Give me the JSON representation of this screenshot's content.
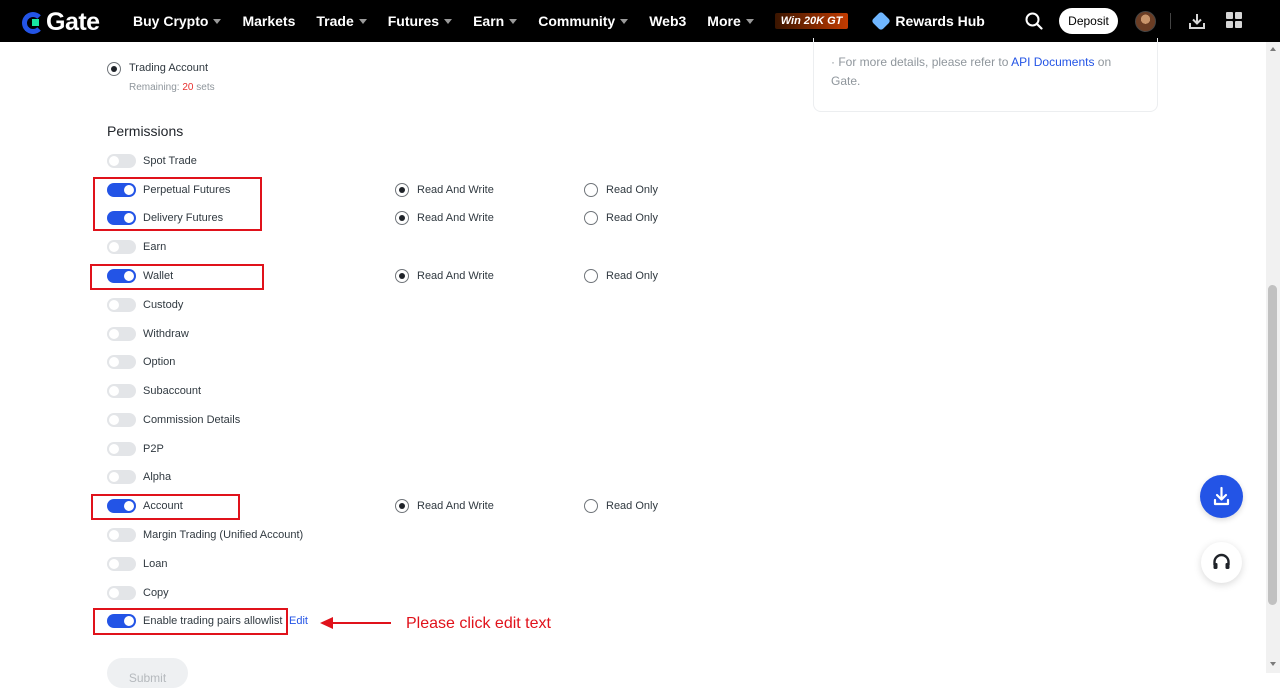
{
  "header": {
    "logo_text": "Gate",
    "nav": [
      {
        "label": "Buy Crypto",
        "dropdown": true
      },
      {
        "label": "Markets",
        "dropdown": false
      },
      {
        "label": "Trade",
        "dropdown": true
      },
      {
        "label": "Futures",
        "dropdown": true
      },
      {
        "label": "Earn",
        "dropdown": true
      },
      {
        "label": "Community",
        "dropdown": true
      },
      {
        "label": "Web3",
        "dropdown": false
      },
      {
        "label": "More",
        "dropdown": true
      }
    ],
    "promo_label": "Win 20K GT",
    "rewards_label": "Rewards Hub",
    "deposit_label": "Deposit"
  },
  "account_type": {
    "option_label": "Trading Account",
    "selected": true,
    "remaining_prefix": "Remaining: ",
    "remaining_count": "20",
    "remaining_suffix": " sets"
  },
  "permissions": {
    "title": "Permissions",
    "rw_label": "Read And Write",
    "ro_label": "Read Only",
    "items": [
      {
        "label": "Spot Trade",
        "enabled": false
      },
      {
        "label": "Perpetual Futures",
        "enabled": true,
        "mode": "Read And Write"
      },
      {
        "label": "Delivery Futures",
        "enabled": true,
        "mode": "Read And Write"
      },
      {
        "label": "Earn",
        "enabled": false
      },
      {
        "label": "Wallet",
        "enabled": true,
        "mode": "Read And Write"
      },
      {
        "label": "Custody",
        "enabled": false
      },
      {
        "label": "Withdraw",
        "enabled": false
      },
      {
        "label": "Option",
        "enabled": false
      },
      {
        "label": "Subaccount",
        "enabled": false
      },
      {
        "label": "Commission Details",
        "enabled": false
      },
      {
        "label": "P2P",
        "enabled": false
      },
      {
        "label": "Alpha",
        "enabled": false
      },
      {
        "label": "Account",
        "enabled": true,
        "mode": "Read And Write"
      },
      {
        "label": "Margin Trading (Unified Account)",
        "enabled": false
      },
      {
        "label": "Loan",
        "enabled": false
      },
      {
        "label": "Copy",
        "enabled": false
      },
      {
        "label": "Enable trading pairs allowlist",
        "enabled": true
      }
    ],
    "edit_label": "Edit"
  },
  "annotation": {
    "text": "Please click edit text",
    "color": "#e0121b"
  },
  "info": {
    "prefix": "· For more details, please refer to ",
    "link": "API Documents",
    "suffix": " on Gate."
  },
  "submit_label": "Submit",
  "colors": {
    "accent": "#2354e6",
    "highlight": "#e0121b",
    "remaining": "#e8302f"
  }
}
